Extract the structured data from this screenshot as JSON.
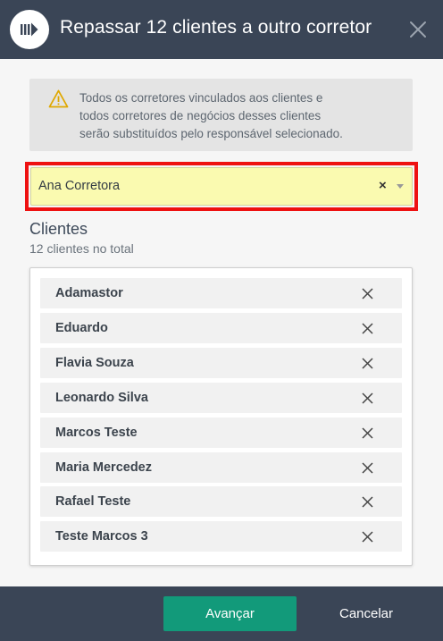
{
  "header": {
    "logo_icon": "arrow-chevron-logo-icon",
    "title": "Repassar 12 clientes a outro corretor",
    "close_icon": "close-icon"
  },
  "warning": {
    "icon": "warning-triangle-icon",
    "color": "#e0a800",
    "line1": "Todos os corretores vinculados aos clientes e",
    "line2": "todos corretores de negócios desses clientes",
    "line3": "serão substituídos pelo responsável selecionado."
  },
  "select": {
    "value": "Ana Corretora",
    "clear_label": "×",
    "highlight_color": "#ee1111"
  },
  "clients": {
    "title": "Clientes",
    "subtitle": "12 clientes no total",
    "items": [
      {
        "name": "Adamastor"
      },
      {
        "name": "Eduardo"
      },
      {
        "name": "Flavia Souza"
      },
      {
        "name": "Leonardo Silva"
      },
      {
        "name": "Marcos Teste"
      },
      {
        "name": "Maria Mercedez"
      },
      {
        "name": "Rafael Teste"
      },
      {
        "name": "Teste Marcos 3"
      }
    ]
  },
  "footer": {
    "primary_label": "Avançar",
    "cancel_label": "Cancelar",
    "primary_color": "#129a7a"
  }
}
